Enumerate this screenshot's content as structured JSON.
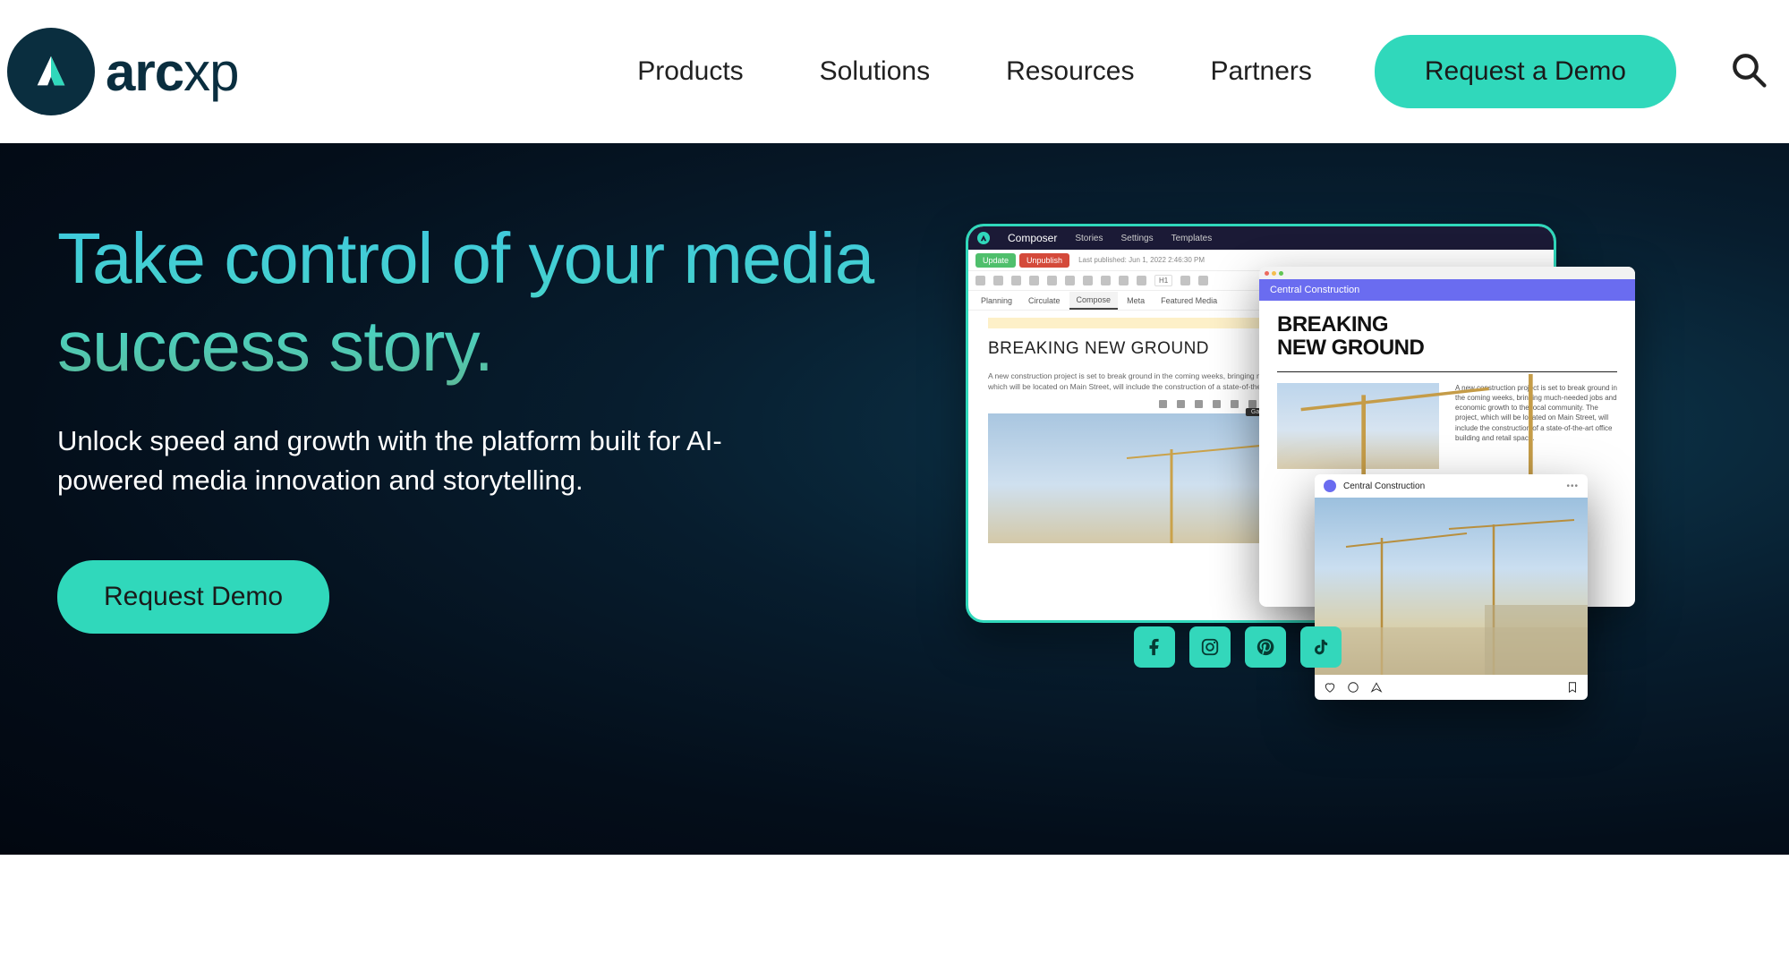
{
  "brand": {
    "name_bold": "arc",
    "name_light": "xp"
  },
  "nav": {
    "items": [
      "Products",
      "Solutions",
      "Resources",
      "Partners"
    ],
    "cta": "Request a Demo"
  },
  "hero": {
    "heading": "Take control of your media success story.",
    "subheading": "Unlock speed and growth with the platform built for AI-powered media innovation and storytelling.",
    "cta": "Request Demo"
  },
  "composer": {
    "app_title": "Composer",
    "top_tabs": [
      "Stories",
      "Settings",
      "Templates"
    ],
    "update_btn": "Update",
    "unpublish_btn": "Unpublish",
    "last_published": "Last published: Jun 1, 2022 2:46:30 PM",
    "format_h": "H1",
    "content_tabs": [
      "Planning",
      "Circulate",
      "Compose",
      "Meta",
      "Featured Media"
    ],
    "article_headline": "BREAKING NEW GROUND",
    "article_body": "A new construction project is set to break ground in the coming weeks, bringing much-needed jobs and economic growth to the local community. The project, which will be located on Main Street, will include the construction of a state-of-the-art office building and retail space.",
    "gallery_tooltip": "Gallery"
  },
  "site_preview": {
    "site_name": "Central Construction",
    "headline_line1": "BREAKING",
    "headline_line2": "NEW GROUND",
    "excerpt": "A new construction project is set to break ground in the coming weeks, bringing much-needed jobs and economic growth to the local community. The project, which will be located on Main Street, will include the construction of a state-of-the-art office building and retail space."
  },
  "social_post": {
    "author": "Central Construction"
  },
  "share_icons": [
    "facebook",
    "instagram",
    "pinterest",
    "tiktok"
  ],
  "colors": {
    "accent": "#30d8bb",
    "dark": "#0a2e3f"
  }
}
